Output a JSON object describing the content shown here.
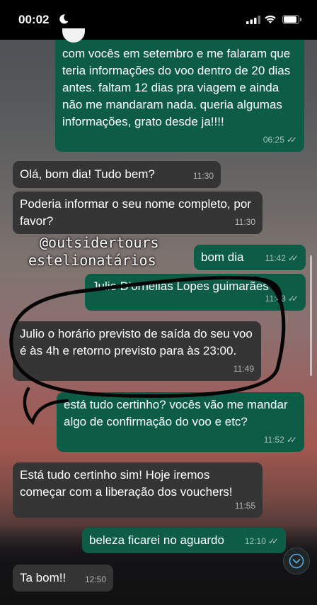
{
  "status_bar": {
    "time": "00:02"
  },
  "messages": [
    {
      "dir": "out",
      "text": "com vocês em setembro e me falaram que teria informações do voo dentro de 20 dias antes. faltam 12 dias pra viagem e ainda não me mandaram nada. queria algumas informações, grato desde ja!!!!",
      "time": "06:25",
      "read": true
    },
    {
      "dir": "in",
      "text": "Olá, bom dia! Tudo bem?",
      "time": "11:30"
    },
    {
      "dir": "in",
      "text": "Poderia informar o seu nome completo, por favor?",
      "time": "11:30"
    },
    {
      "dir": "out",
      "text": "bom dia",
      "time": "11:42",
      "read": true
    },
    {
      "dir": "out",
      "text": "Julio D'ornellas Lopes guimarães",
      "time": "11:43",
      "read": true
    },
    {
      "dir": "in",
      "text": "Julio o horário previsto de saída do seu voo é às 4h e retorno previsto para às 23:00.",
      "time": "11:49"
    },
    {
      "dir": "out",
      "text": "está tudo certinho? vocês vão me mandar algo de confirmação do voo e etc?",
      "time": "11:52",
      "read": true
    },
    {
      "dir": "in",
      "text": "Está tudo certinho sim! Hoje iremos começar com a liberação dos vouchers!",
      "time": "11:55"
    },
    {
      "dir": "out",
      "text": "beleza ficarei no aguardo",
      "time": "12:10",
      "read": true
    },
    {
      "dir": "in",
      "text": "Ta bom!!",
      "time": "12:50"
    }
  ],
  "overlay": {
    "line1": "@outsidertours",
    "line2": "estelionatários"
  },
  "colors": {
    "outgoing": "#0d5c46",
    "incoming": "#363536",
    "annotation": "#000000"
  },
  "icons": [
    "moon-icon",
    "signal-icon",
    "wifi-icon",
    "battery-icon",
    "read-receipt-icon",
    "chevron-down-icon"
  ]
}
